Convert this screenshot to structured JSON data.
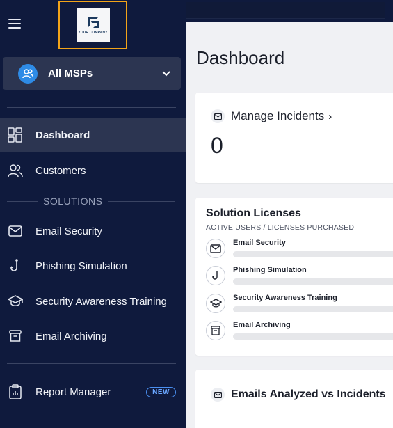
{
  "sidebar": {
    "logo_text": "YOUR COMPANY",
    "msp_selector": {
      "label": "All MSPs"
    },
    "items_top": [
      {
        "label": "Dashboard",
        "icon": "dashboard-icon",
        "active": true
      },
      {
        "label": "Customers",
        "icon": "users-icon",
        "active": false
      }
    ],
    "section_label": "SOLUTIONS",
    "solutions": [
      {
        "label": "Email Security",
        "icon": "mail-icon"
      },
      {
        "label": "Phishing Simulation",
        "icon": "hook-icon"
      },
      {
        "label": "Security Awareness Training",
        "icon": "graduation-cap-icon"
      },
      {
        "label": "Email Archiving",
        "icon": "archive-icon"
      }
    ],
    "report_manager": {
      "label": "Report Manager",
      "badge": "NEW"
    }
  },
  "main": {
    "page_title": "Dashboard",
    "incidents": {
      "title": "Manage Incidents",
      "chevron": "›",
      "count": "0"
    },
    "licenses": {
      "title": "Solution Licenses",
      "subtitle": "ACTIVE USERS / LICENSES PURCHASED",
      "items": [
        {
          "label": "Email Security",
          "icon": "mail-icon",
          "fill": 0
        },
        {
          "label": "Phishing Simulation",
          "icon": "hook-icon",
          "fill": 0
        },
        {
          "label": "Security Awareness Training",
          "icon": "graduation-cap-icon",
          "fill": 0
        },
        {
          "label": "Email Archiving",
          "icon": "archive-icon",
          "fill": 0
        }
      ]
    },
    "emails_analyzed": {
      "title": "Emails Analyzed vs Incidents"
    }
  },
  "colors": {
    "sidebar_bg": "#0f1a3d",
    "active_bg": "#2c3551",
    "accent_badge": "#4a8ff0",
    "logo_frame": "#f2a419",
    "avatar_blue": "#2e8be6"
  }
}
